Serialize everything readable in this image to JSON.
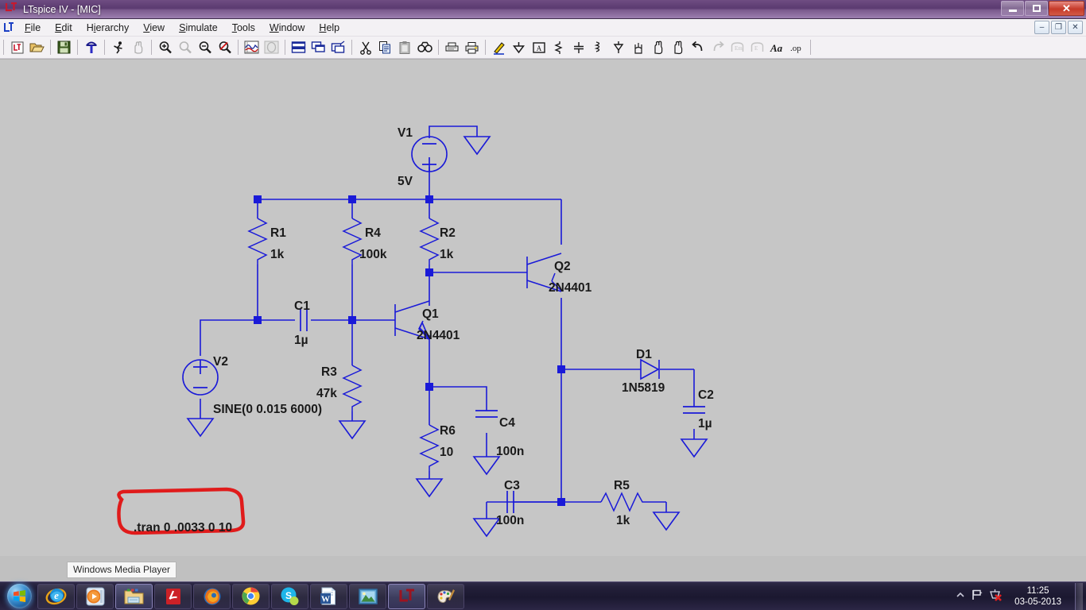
{
  "window": {
    "app_logo": "LT",
    "title": "LTspice IV - [MIC]",
    "minimize_label": "Minimize",
    "restore_label": "Restore",
    "close_label": "✕"
  },
  "mdi_window": {
    "minimize_label": "–",
    "restore_label": "❐",
    "close_label": "✕"
  },
  "menu": {
    "doc_icon": "ltspice-doc-icon",
    "items": [
      {
        "label": "File",
        "accel": "F"
      },
      {
        "label": "Edit",
        "accel": "E"
      },
      {
        "label": "Hierarchy",
        "accel": "i"
      },
      {
        "label": "View",
        "accel": "V"
      },
      {
        "label": "Simulate",
        "accel": "S"
      },
      {
        "label": "Tools",
        "accel": "T"
      },
      {
        "label": "Window",
        "accel": "W"
      },
      {
        "label": "Help",
        "accel": "H"
      }
    ]
  },
  "toolbar": {
    "groups": [
      [
        "new-schematic-icon",
        "open-file-icon"
      ],
      [
        "save-file-icon"
      ],
      [
        "run-probe-icon"
      ],
      [
        "run-simulation-icon",
        "pan-hand-icon"
      ],
      [
        "zoom-in-icon",
        "zoom-area-icon",
        "zoom-out-icon",
        "zoom-fit-icon"
      ],
      [
        "waveform-view-icon",
        "spice-error-log-icon"
      ],
      [
        "tile-horizontal-icon",
        "tile-vertical-icon",
        "cascade-windows-icon"
      ],
      [
        "cut-icon",
        "copy-icon",
        "paste-icon",
        "find-icon"
      ],
      [
        "print-preview-icon",
        "print-icon"
      ],
      [
        "draw-wire-icon",
        "place-ground-icon",
        "place-label-icon",
        "place-resistor-icon",
        "place-capacitor-icon",
        "place-inductor-icon",
        "place-diode-icon",
        "place-component-icon",
        "move-icon",
        "drag-icon"
      ],
      [
        "undo-icon",
        "redo-icon",
        "rotate-icon",
        "mirror-icon",
        "place-text-icon",
        "spice-directive-icon"
      ]
    ]
  },
  "schematic": {
    "wire_color": "#1a1ad8",
    "junction_color": "#1a1ad8",
    "label_color": "#1a1a1a",
    "annotation_color": "#e01b1b",
    "background": "#c6c6c6",
    "components": [
      {
        "id": "V1",
        "type": "voltage-source",
        "name": "V1",
        "value": "5V",
        "polarity_top": "−",
        "polarity_bottom": "+"
      },
      {
        "id": "V2",
        "type": "voltage-source",
        "name": "V2",
        "value": "SINE(0 0.015 6000)",
        "polarity_top": "+",
        "polarity_bottom": "−"
      },
      {
        "id": "R1",
        "type": "resistor",
        "name": "R1",
        "value": "1k",
        "orientation": "vertical"
      },
      {
        "id": "R2",
        "type": "resistor",
        "name": "R2",
        "value": "1k",
        "orientation": "vertical"
      },
      {
        "id": "R3",
        "type": "resistor",
        "name": "R3",
        "value": "47k",
        "orientation": "vertical"
      },
      {
        "id": "R4",
        "type": "resistor",
        "name": "R4",
        "value": "100k",
        "orientation": "vertical"
      },
      {
        "id": "R5",
        "type": "resistor",
        "name": "R5",
        "value": "1k",
        "orientation": "horizontal"
      },
      {
        "id": "R6",
        "type": "resistor",
        "name": "R6",
        "value": "10",
        "orientation": "vertical"
      },
      {
        "id": "C1",
        "type": "capacitor",
        "name": "C1",
        "value": "1µ",
        "orientation": "horizontal"
      },
      {
        "id": "C2",
        "type": "capacitor",
        "name": "C2",
        "value": "1µ",
        "orientation": "vertical"
      },
      {
        "id": "C3",
        "type": "capacitor",
        "name": "C3",
        "value": "100n",
        "orientation": "horizontal"
      },
      {
        "id": "C4",
        "type": "capacitor",
        "name": "C4",
        "value": "100n",
        "orientation": "vertical"
      },
      {
        "id": "Q1",
        "type": "npn-transistor",
        "name": "Q1",
        "value": "2N4401"
      },
      {
        "id": "Q2",
        "type": "npn-transistor",
        "name": "Q2",
        "value": "2N4401"
      },
      {
        "id": "D1",
        "type": "diode",
        "name": "D1",
        "value": "1N5819"
      }
    ],
    "directive": {
      "text": ".tran 0 .0033 0 10",
      "highlighted": true,
      "highlight_color": "#e01b1b"
    }
  },
  "taskbar": {
    "tooltip": "Windows Media Player",
    "start_label": "Start",
    "items": [
      {
        "name": "internet-explorer",
        "active": false
      },
      {
        "name": "windows-media-player",
        "active": false
      },
      {
        "name": "windows-explorer",
        "active": true
      },
      {
        "name": "adobe-reader",
        "active": false
      },
      {
        "name": "mozilla-firefox",
        "active": false
      },
      {
        "name": "google-chrome",
        "active": false
      },
      {
        "name": "skype",
        "active": false
      },
      {
        "name": "microsoft-word",
        "active": false
      },
      {
        "name": "windows-photo-viewer",
        "active": false
      },
      {
        "name": "ltspice",
        "active": true
      },
      {
        "name": "microsoft-paint",
        "active": false
      }
    ],
    "tray": {
      "show_hidden_icons": "▲",
      "action_center": "flag-icon",
      "network_status": "network-disconnected-icon",
      "time": "11:25",
      "date": "03-05-2013"
    }
  }
}
